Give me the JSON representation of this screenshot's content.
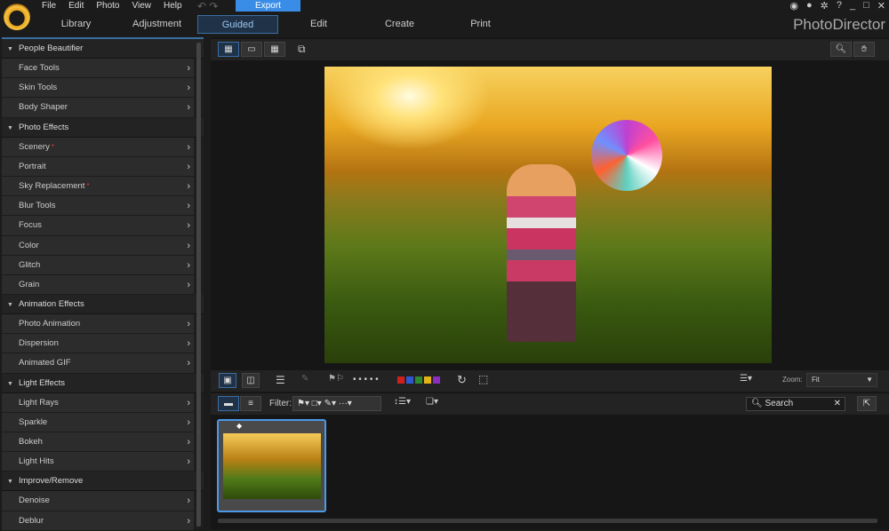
{
  "app": {
    "brand": "PhotoDirector",
    "export_label": "Export"
  },
  "menu": [
    "File",
    "Edit",
    "Photo",
    "View",
    "Help"
  ],
  "tabs": [
    "Library",
    "Adjustment",
    "Guided",
    "Edit",
    "Create",
    "Print"
  ],
  "active_tab": "Guided",
  "sidebar": [
    {
      "title": "People Beautifier",
      "items": [
        {
          "label": "Face Tools"
        },
        {
          "label": "Skin Tools"
        },
        {
          "label": "Body Shaper"
        }
      ]
    },
    {
      "title": "Photo Effects",
      "items": [
        {
          "label": "Scenery",
          "new": "*"
        },
        {
          "label": "Portrait"
        },
        {
          "label": "Sky Replacement",
          "new": "*"
        },
        {
          "label": "Blur Tools"
        },
        {
          "label": "Focus"
        },
        {
          "label": "Color"
        },
        {
          "label": "Glitch"
        },
        {
          "label": "Grain"
        }
      ]
    },
    {
      "title": "Animation Effects",
      "items": [
        {
          "label": "Photo Animation"
        },
        {
          "label": "Dispersion"
        },
        {
          "label": "Animated GIF"
        }
      ]
    },
    {
      "title": "Light Effects",
      "items": [
        {
          "label": "Light Rays"
        },
        {
          "label": "Sparkle"
        },
        {
          "label": "Bokeh"
        },
        {
          "label": "Light Hits"
        }
      ]
    },
    {
      "title": "Improve/Remove",
      "items": [
        {
          "label": "Denoise"
        },
        {
          "label": "Deblur"
        }
      ]
    }
  ],
  "toolbar": {
    "zoom_label": "Zoom:",
    "zoom_value": "Fit",
    "rating_dots": "• • • • •"
  },
  "color_labels": [
    "#d0201e",
    "#2f58d0",
    "#2e8a2e",
    "#e6b21a",
    "#8a2ec0"
  ],
  "filter": {
    "label": "Filter:",
    "search_placeholder": "Search"
  }
}
